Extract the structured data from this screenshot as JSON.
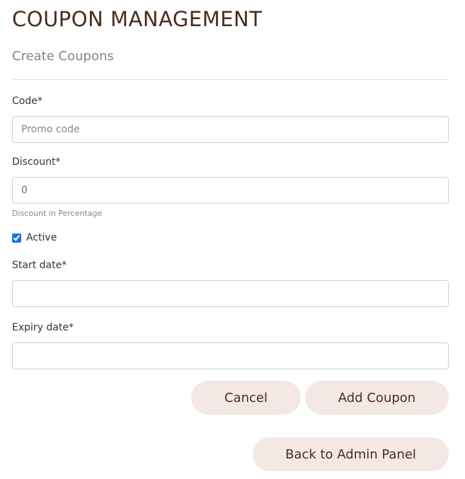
{
  "header": {
    "title": "COUPON MANAGEMENT"
  },
  "form": {
    "section_title": "Create Coupons",
    "code": {
      "label": "Code*",
      "placeholder": "Promo code",
      "value": ""
    },
    "discount": {
      "label": "Discount*",
      "value": "0",
      "help": "Discount in Percentage"
    },
    "active": {
      "label": "Active",
      "checked": true
    },
    "start_date": {
      "label": "Start date*",
      "value": ""
    },
    "expiry_date": {
      "label": "Expiry date*",
      "value": ""
    },
    "buttons": {
      "cancel": "Cancel",
      "add": "Add Coupon"
    }
  },
  "footer": {
    "back_label": "Back to Admin Panel"
  },
  "colors": {
    "title": "#4a2c1e",
    "button_bg": "#f4e8e4",
    "checkbox_accent": "#1a73e8"
  }
}
